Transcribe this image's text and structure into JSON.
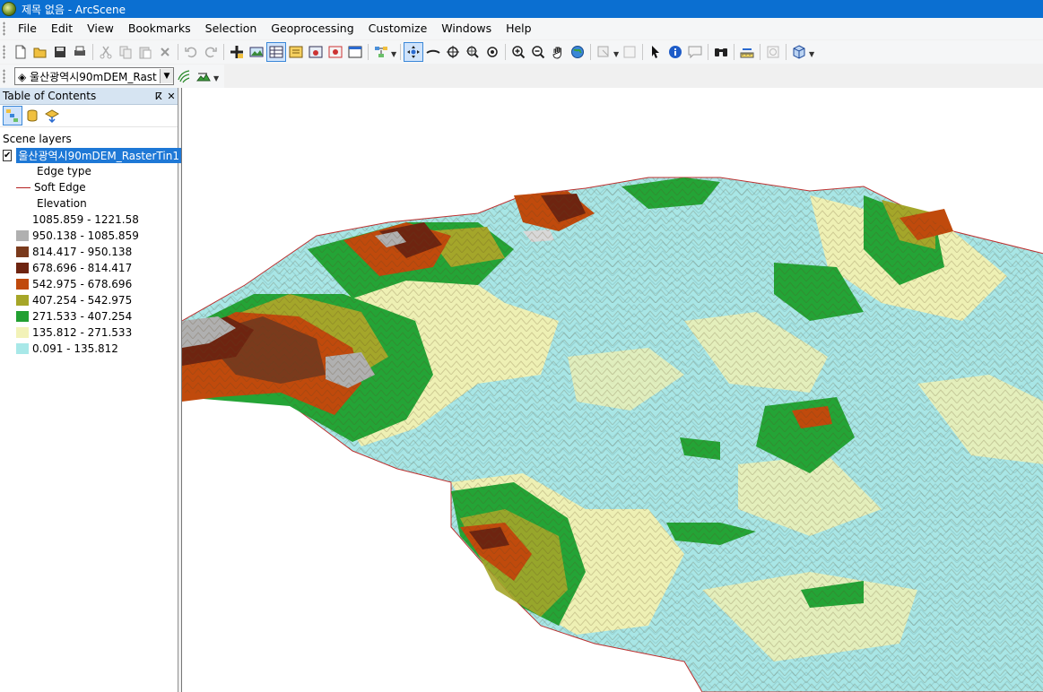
{
  "window": {
    "title": "제목 없음 - ArcScene"
  },
  "menu": [
    "File",
    "Edit",
    "View",
    "Bookmarks",
    "Selection",
    "Geoprocessing",
    "Customize",
    "Windows",
    "Help"
  ],
  "toolbar": {
    "layer_combo": "울산광역시90mDEM_Rast",
    "icons": [
      "new-icon",
      "open-icon",
      "save-icon",
      "print-icon",
      "cut-icon",
      "copy-icon",
      "paste-icon",
      "delete-icon",
      "undo-icon",
      "redo-icon",
      "add-data-icon",
      "add-layer-icon",
      "table-icon",
      "animation-icon",
      "layer-properties-icon",
      "scene-properties-icon",
      "toggle-icon",
      "navigate-icon",
      "fly-icon",
      "center-target-icon",
      "zoom-target-icon",
      "set-observer-icon",
      "zoom-in-icon",
      "zoom-out-icon",
      "pan-icon",
      "full-extent-icon",
      "select-features-icon",
      "clear-select-icon",
      "select-elements-icon",
      "identify-icon",
      "html-popup-icon",
      "find-icon",
      "measure-icon",
      "time-slider-icon",
      "3d-effects-icon"
    ]
  },
  "toc": {
    "title": "Table of Contents",
    "group": "Scene layers",
    "layer": "울산광역시90mDEM_RasterTin1",
    "edge_type_label": "Edge type",
    "soft_edge": "Soft Edge",
    "elevation_label": "Elevation",
    "classes": [
      {
        "label": "1085.859 - 1221.58",
        "color": "#ffffff"
      },
      {
        "label": "950.138 - 1085.859",
        "color": "#b0b0b0"
      },
      {
        "label": "814.417 - 950.138",
        "color": "#7a3a1c"
      },
      {
        "label": "678.696 - 814.417",
        "color": "#6e2410"
      },
      {
        "label": "542.975 - 678.696",
        "color": "#c04a0c"
      },
      {
        "label": "407.254 - 542.975",
        "color": "#a6a628"
      },
      {
        "label": "271.533 - 407.254",
        "color": "#22a032"
      },
      {
        "label": "135.812 - 271.533",
        "color": "#f2f2b8"
      },
      {
        "label": "0.091 - 135.812",
        "color": "#a8e8e8"
      }
    ]
  }
}
